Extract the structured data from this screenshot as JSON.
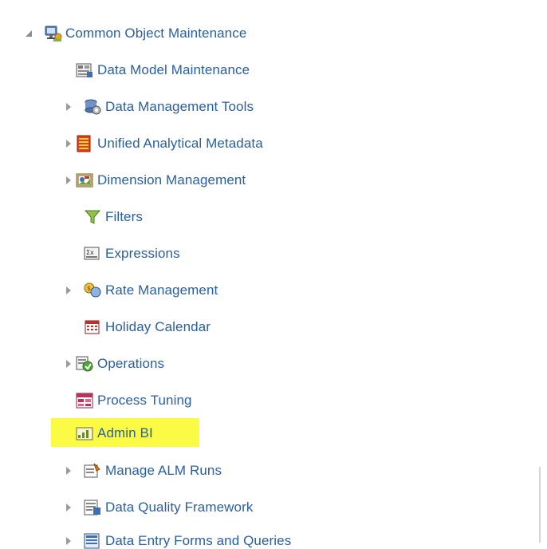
{
  "tree": {
    "root": {
      "label": "Common Object Maintenance",
      "icon": "network-computer-icon",
      "expanded": true
    },
    "items": [
      {
        "label": "Data Model Maintenance",
        "icon": "data-model-icon",
        "expandable": false
      },
      {
        "label": "Data Management Tools",
        "icon": "data-management-tools-icon",
        "expandable": true
      },
      {
        "label": "Unified Analytical Metadata",
        "icon": "metadata-icon",
        "expandable": true
      },
      {
        "label": "Dimension Management",
        "icon": "dimension-management-icon",
        "expandable": true
      },
      {
        "label": "Filters",
        "icon": "filter-icon",
        "expandable": false
      },
      {
        "label": "Expressions",
        "icon": "expressions-icon",
        "expandable": false
      },
      {
        "label": "Rate Management",
        "icon": "rate-management-icon",
        "expandable": true
      },
      {
        "label": "Holiday Calendar",
        "icon": "calendar-icon",
        "expandable": false
      },
      {
        "label": "Operations",
        "icon": "operations-icon",
        "expandable": true
      },
      {
        "label": "Process Tuning",
        "icon": "process-tuning-icon",
        "expandable": false
      },
      {
        "label": "Admin BI",
        "icon": "admin-bi-icon",
        "expandable": false,
        "highlighted": true
      },
      {
        "label": "Manage ALM Runs",
        "icon": "manage-runs-icon",
        "expandable": true
      },
      {
        "label": "Data Quality Framework",
        "icon": "data-quality-icon",
        "expandable": true
      },
      {
        "label": "Data Entry Forms and Queries",
        "icon": "data-entry-forms-icon",
        "expandable": true
      }
    ]
  },
  "colors": {
    "link": "#2a5f9e",
    "highlight": "#fbfb46",
    "expander": "#9a9a9a"
  }
}
